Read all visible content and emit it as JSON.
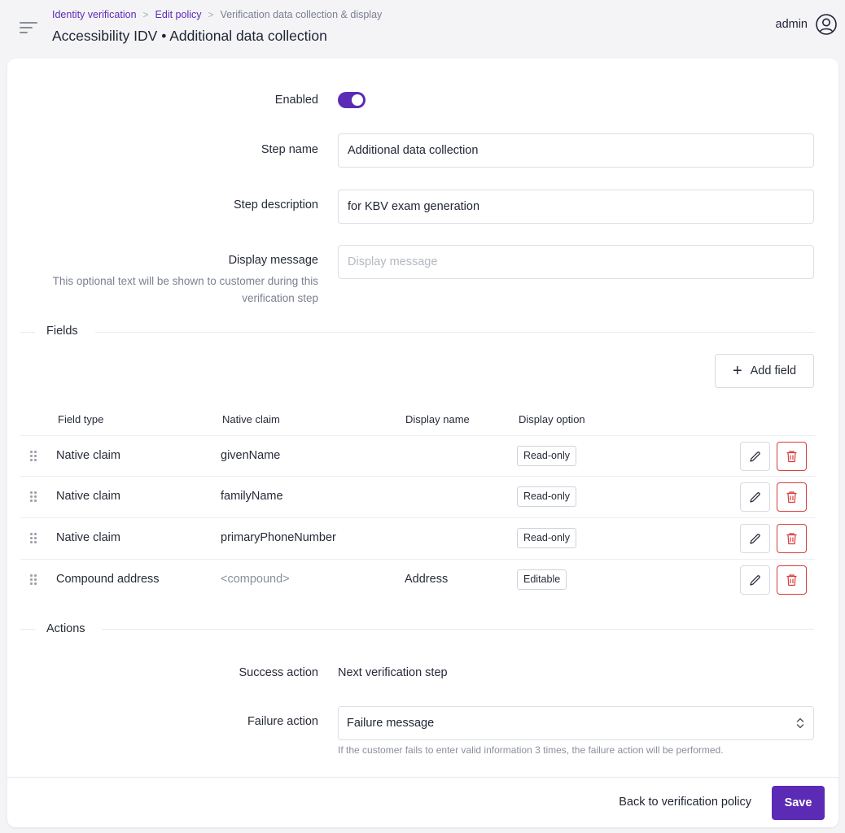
{
  "header": {
    "breadcrumb": [
      "Identity verification",
      "Edit policy",
      "Verification data collection & display"
    ],
    "title": "Accessibility IDV • Additional data collection",
    "user": "admin"
  },
  "form": {
    "enabled_label": "Enabled",
    "enabled": true,
    "step_name_label": "Step name",
    "step_name_value": "Additional data collection",
    "step_description_label": "Step description",
    "step_description_value": "for KBV exam generation",
    "display_message_label": "Display message",
    "display_message_placeholder": "Display message",
    "display_message_hint": "This optional text will be shown to customer during this verification step"
  },
  "fields": {
    "section_title": "Fields",
    "add_button": "Add field",
    "columns": [
      "Field type",
      "Native claim",
      "Display name",
      "Display option"
    ],
    "rows": [
      {
        "type": "Native claim",
        "claim": "givenName",
        "display_name": "",
        "option": "Read-only"
      },
      {
        "type": "Native claim",
        "claim": "familyName",
        "display_name": "",
        "option": "Read-only"
      },
      {
        "type": "Native claim",
        "claim": "primaryPhoneNumber",
        "display_name": "",
        "option": "Read-only"
      },
      {
        "type": "Compound address",
        "claim": "<compound>",
        "display_name": "Address",
        "option": "Editable"
      }
    ]
  },
  "actions": {
    "section_title": "Actions",
    "success_label": "Success action",
    "success_value": "Next verification step",
    "failure_label": "Failure action",
    "failure_value": "Failure message",
    "failure_hint": "If the customer fails to enter valid information 3 times, the failure action will be performed."
  },
  "footer": {
    "back_label": "Back to verification policy",
    "save_label": "Save"
  },
  "colors": {
    "accent": "#5b2bb5",
    "danger": "#d93b3b"
  }
}
